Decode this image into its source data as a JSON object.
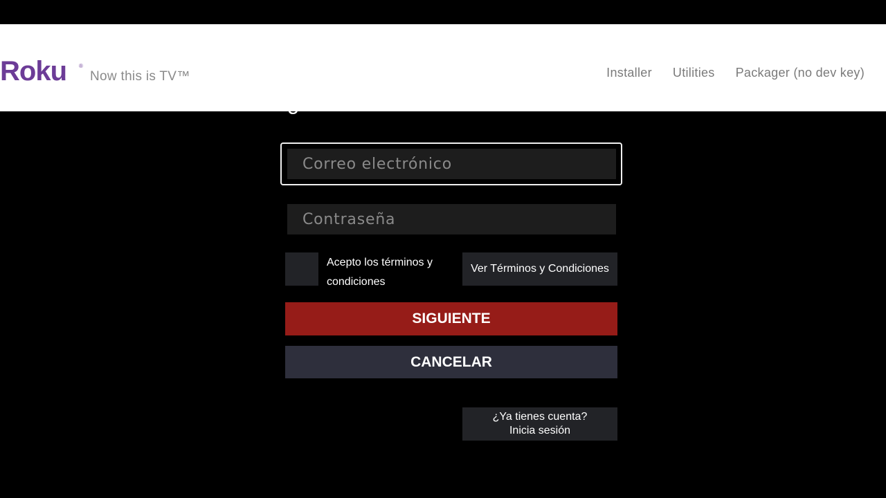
{
  "header": {
    "logo_text": "Roku",
    "logo_registered": "®",
    "tagline": "Now this is TV™",
    "nav": [
      "Installer",
      "Utilities",
      "Packager (no dev key)"
    ]
  },
  "form": {
    "heading": "¿Cuál es tu correo electrónico?",
    "email_placeholder": "Correo electrónico",
    "password_placeholder": "Contraseña",
    "accept_terms_label": "Acepto los términos y condiciones",
    "accept_terms_checked": false,
    "view_terms_label": "Ver Términos y Condiciones",
    "next_label": "SIGUIENTE",
    "cancel_label": "CANCELAR",
    "have_account_line1": "¿Ya tienes cuenta?",
    "have_account_line2": "Inicia sesión"
  },
  "colors": {
    "brand_purple": "#6c3c97",
    "next_button": "#961c18",
    "cancel_button": "#2e2f3c",
    "background": "#000000"
  }
}
